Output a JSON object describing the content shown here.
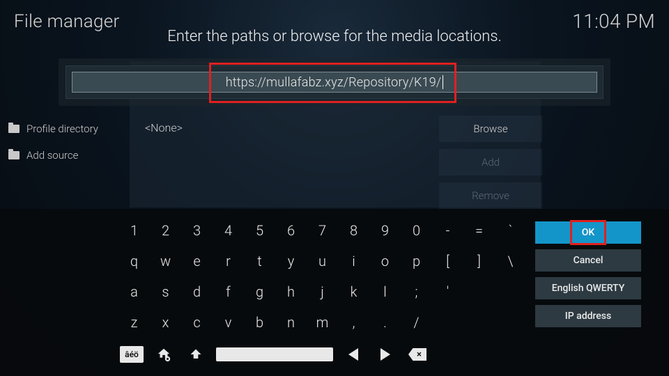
{
  "header": {
    "title": "File manager",
    "clock": "11:04 PM"
  },
  "sidebar": {
    "items": [
      {
        "label": "Profile directory"
      },
      {
        "label": "Add source"
      }
    ]
  },
  "dialog": {
    "prompt": "Enter the paths or browse for the media locations.",
    "input_value": "https://mullafabz.xyz/Repository/K19/",
    "none_label": "<None>",
    "buttons": {
      "browse": "Browse",
      "add": "Add",
      "remove": "Remove"
    }
  },
  "keyboard": {
    "rows": [
      [
        "1",
        "2",
        "3",
        "4",
        "5",
        "6",
        "7",
        "8",
        "9",
        "0",
        "-",
        "=",
        "`"
      ],
      [
        "q",
        "w",
        "e",
        "r",
        "t",
        "y",
        "u",
        "i",
        "o",
        "p",
        "[",
        "]",
        "\\"
      ],
      [
        "a",
        "s",
        "d",
        "f",
        "g",
        "h",
        "j",
        "k",
        "l",
        ";",
        "'"
      ],
      [
        "z",
        "x",
        "c",
        "v",
        "b",
        "n",
        "m",
        ",",
        ".",
        "/"
      ]
    ],
    "accent_label": "âéö"
  },
  "actions": {
    "ok": "OK",
    "cancel": "Cancel",
    "layout": "English QWERTY",
    "ip": "IP address"
  }
}
